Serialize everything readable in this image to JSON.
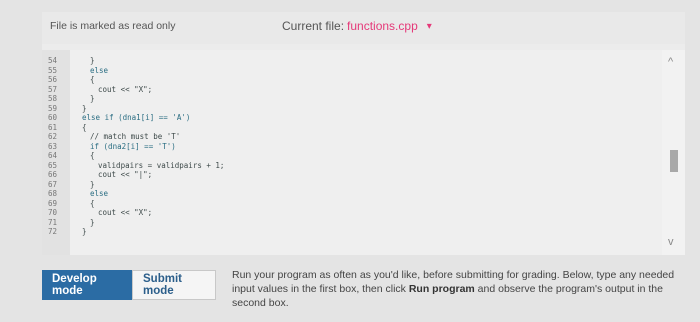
{
  "header": {
    "read_only_note": "File is marked as read only",
    "current_file_label": "Current file:",
    "current_file_name": "functions.cpp",
    "dropdown_caret": "▾"
  },
  "editor": {
    "lines": [
      {
        "num": "54",
        "text": "}"
      },
      {
        "num": "55",
        "text": "else"
      },
      {
        "num": "56",
        "text": "{"
      },
      {
        "num": "57",
        "text": "cout << \"X\";"
      },
      {
        "num": "58",
        "text": "}"
      },
      {
        "num": "59",
        "text": "}"
      },
      {
        "num": "60",
        "text": "else if (dna1[i] == 'A')"
      },
      {
        "num": "61",
        "text": "{"
      },
      {
        "num": "62",
        "text": "// match must be 'T'"
      },
      {
        "num": "63",
        "text": "if (dna2[i] == 'T')"
      },
      {
        "num": "64",
        "text": "{"
      },
      {
        "num": "65",
        "text": "validpairs = validpairs + 1;"
      },
      {
        "num": "66",
        "text": "cout << \"|\";"
      },
      {
        "num": "67",
        "text": "}"
      },
      {
        "num": "68",
        "text": "else"
      },
      {
        "num": "69",
        "text": "{"
      },
      {
        "num": "70",
        "text": "cout << \"X\";"
      },
      {
        "num": "71",
        "text": "}"
      },
      {
        "num": "72",
        "text": "}"
      }
    ]
  },
  "scrollbar": {
    "up_icon": "^",
    "down_icon": "v"
  },
  "modes": {
    "develop_label": "Develop mode",
    "submit_label": "Submit mode"
  },
  "instructions": {
    "part1": "Run your program as often as you'd like, before submitting for grading. Below, type any needed input values in the first box, then click ",
    "run_label": "Run program",
    "part2": " and observe the program's output in the second box."
  }
}
